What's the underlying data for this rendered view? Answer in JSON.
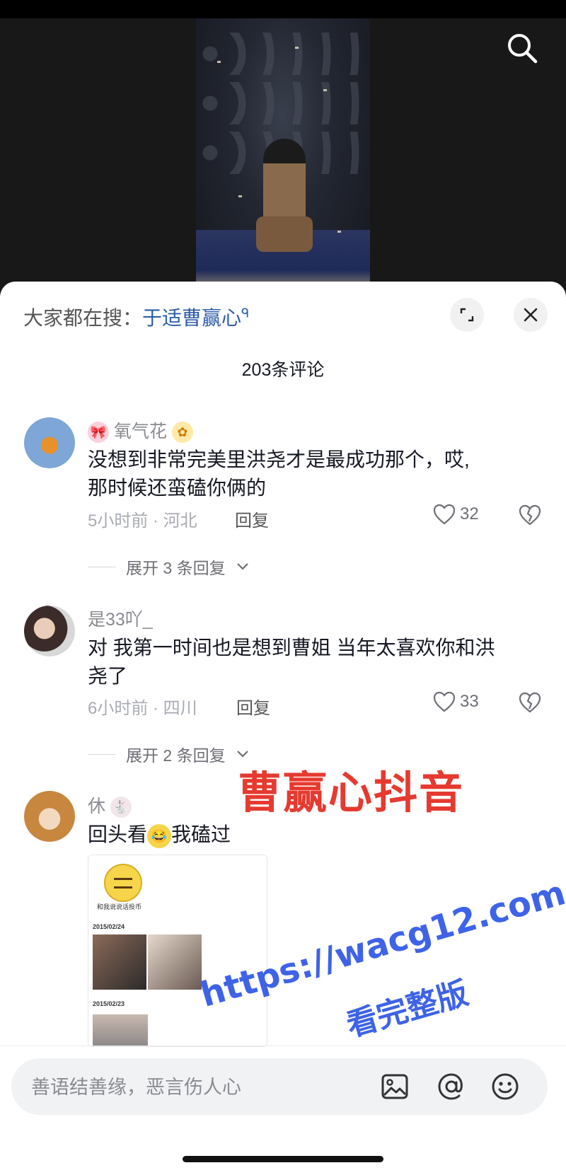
{
  "hot_search": {
    "label": "大家都在搜：",
    "term": "于适曹赢心",
    "search_glyph": "ᑫ"
  },
  "comment_count_title": "203条评论",
  "comments": [
    {
      "name": "氧气花",
      "text_line1": "没想到非常完美里洪尧才是最成功那个，哎,",
      "text_line2": "那时候还蛮磕你俩的",
      "meta": "5小时前 · 河北",
      "reply_label": "回复",
      "likes": "32",
      "expand_label": "展开 3 条回复"
    },
    {
      "name": "是33吖_",
      "text_line1": "对 我第一时间也是想到曹姐 当年太喜欢你和洪",
      "text_line2": "尧了",
      "meta": "6小时前 · 四川",
      "reply_label": "回复",
      "likes": "33",
      "expand_label": "展开 2 条回复"
    },
    {
      "name": "休",
      "text_before": "回头看",
      "text_after": "我磕过",
      "attachment": {
        "caption": "和我说说话投币",
        "date1": "2015/02/24",
        "date2": "2015/02/23"
      }
    }
  ],
  "watermarks": {
    "red_text": "曹赢心抖音",
    "url_text": "https://wacg12.com",
    "blue_text": "看完整版"
  },
  "input_placeholder": "善语结善缘，恶言伤人心",
  "icons": [
    "search-icon",
    "expand-icon",
    "close-icon",
    "heart-icon",
    "broken-heart-icon",
    "chevron-down-icon",
    "image-icon",
    "at-icon",
    "smile-icon"
  ],
  "colors": {
    "accent_link": "#2d5da8",
    "watermark_red": "#e63a30",
    "watermark_blue": "#3e63e8"
  }
}
